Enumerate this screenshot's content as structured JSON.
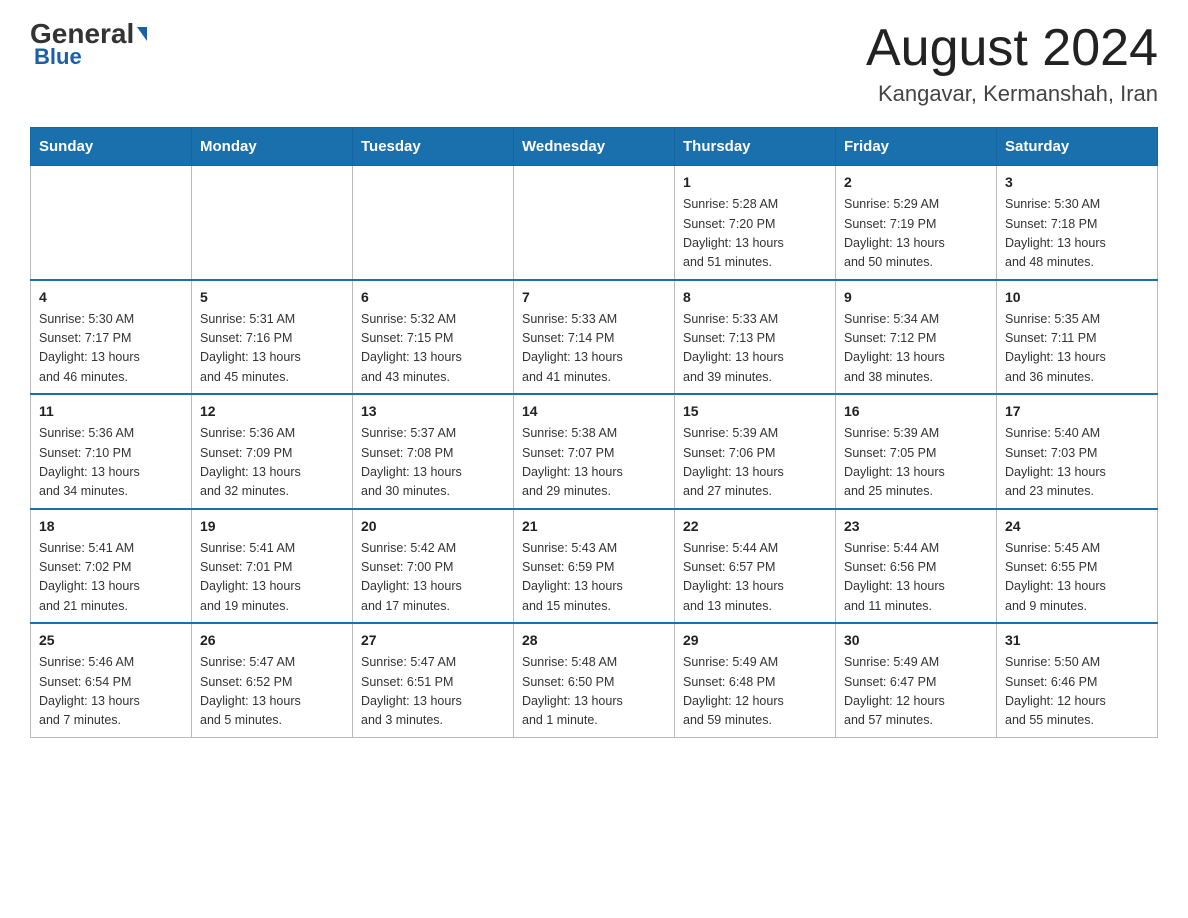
{
  "header": {
    "logo_general": "General",
    "logo_blue": "Blue",
    "month_title": "August 2024",
    "location": "Kangavar, Kermanshah, Iran"
  },
  "days_of_week": [
    "Sunday",
    "Monday",
    "Tuesday",
    "Wednesday",
    "Thursday",
    "Friday",
    "Saturday"
  ],
  "weeks": [
    [
      {
        "day": "",
        "info": ""
      },
      {
        "day": "",
        "info": ""
      },
      {
        "day": "",
        "info": ""
      },
      {
        "day": "",
        "info": ""
      },
      {
        "day": "1",
        "info": "Sunrise: 5:28 AM\nSunset: 7:20 PM\nDaylight: 13 hours\nand 51 minutes."
      },
      {
        "day": "2",
        "info": "Sunrise: 5:29 AM\nSunset: 7:19 PM\nDaylight: 13 hours\nand 50 minutes."
      },
      {
        "day": "3",
        "info": "Sunrise: 5:30 AM\nSunset: 7:18 PM\nDaylight: 13 hours\nand 48 minutes."
      }
    ],
    [
      {
        "day": "4",
        "info": "Sunrise: 5:30 AM\nSunset: 7:17 PM\nDaylight: 13 hours\nand 46 minutes."
      },
      {
        "day": "5",
        "info": "Sunrise: 5:31 AM\nSunset: 7:16 PM\nDaylight: 13 hours\nand 45 minutes."
      },
      {
        "day": "6",
        "info": "Sunrise: 5:32 AM\nSunset: 7:15 PM\nDaylight: 13 hours\nand 43 minutes."
      },
      {
        "day": "7",
        "info": "Sunrise: 5:33 AM\nSunset: 7:14 PM\nDaylight: 13 hours\nand 41 minutes."
      },
      {
        "day": "8",
        "info": "Sunrise: 5:33 AM\nSunset: 7:13 PM\nDaylight: 13 hours\nand 39 minutes."
      },
      {
        "day": "9",
        "info": "Sunrise: 5:34 AM\nSunset: 7:12 PM\nDaylight: 13 hours\nand 38 minutes."
      },
      {
        "day": "10",
        "info": "Sunrise: 5:35 AM\nSunset: 7:11 PM\nDaylight: 13 hours\nand 36 minutes."
      }
    ],
    [
      {
        "day": "11",
        "info": "Sunrise: 5:36 AM\nSunset: 7:10 PM\nDaylight: 13 hours\nand 34 minutes."
      },
      {
        "day": "12",
        "info": "Sunrise: 5:36 AM\nSunset: 7:09 PM\nDaylight: 13 hours\nand 32 minutes."
      },
      {
        "day": "13",
        "info": "Sunrise: 5:37 AM\nSunset: 7:08 PM\nDaylight: 13 hours\nand 30 minutes."
      },
      {
        "day": "14",
        "info": "Sunrise: 5:38 AM\nSunset: 7:07 PM\nDaylight: 13 hours\nand 29 minutes."
      },
      {
        "day": "15",
        "info": "Sunrise: 5:39 AM\nSunset: 7:06 PM\nDaylight: 13 hours\nand 27 minutes."
      },
      {
        "day": "16",
        "info": "Sunrise: 5:39 AM\nSunset: 7:05 PM\nDaylight: 13 hours\nand 25 minutes."
      },
      {
        "day": "17",
        "info": "Sunrise: 5:40 AM\nSunset: 7:03 PM\nDaylight: 13 hours\nand 23 minutes."
      }
    ],
    [
      {
        "day": "18",
        "info": "Sunrise: 5:41 AM\nSunset: 7:02 PM\nDaylight: 13 hours\nand 21 minutes."
      },
      {
        "day": "19",
        "info": "Sunrise: 5:41 AM\nSunset: 7:01 PM\nDaylight: 13 hours\nand 19 minutes."
      },
      {
        "day": "20",
        "info": "Sunrise: 5:42 AM\nSunset: 7:00 PM\nDaylight: 13 hours\nand 17 minutes."
      },
      {
        "day": "21",
        "info": "Sunrise: 5:43 AM\nSunset: 6:59 PM\nDaylight: 13 hours\nand 15 minutes."
      },
      {
        "day": "22",
        "info": "Sunrise: 5:44 AM\nSunset: 6:57 PM\nDaylight: 13 hours\nand 13 minutes."
      },
      {
        "day": "23",
        "info": "Sunrise: 5:44 AM\nSunset: 6:56 PM\nDaylight: 13 hours\nand 11 minutes."
      },
      {
        "day": "24",
        "info": "Sunrise: 5:45 AM\nSunset: 6:55 PM\nDaylight: 13 hours\nand 9 minutes."
      }
    ],
    [
      {
        "day": "25",
        "info": "Sunrise: 5:46 AM\nSunset: 6:54 PM\nDaylight: 13 hours\nand 7 minutes."
      },
      {
        "day": "26",
        "info": "Sunrise: 5:47 AM\nSunset: 6:52 PM\nDaylight: 13 hours\nand 5 minutes."
      },
      {
        "day": "27",
        "info": "Sunrise: 5:47 AM\nSunset: 6:51 PM\nDaylight: 13 hours\nand 3 minutes."
      },
      {
        "day": "28",
        "info": "Sunrise: 5:48 AM\nSunset: 6:50 PM\nDaylight: 13 hours\nand 1 minute."
      },
      {
        "day": "29",
        "info": "Sunrise: 5:49 AM\nSunset: 6:48 PM\nDaylight: 12 hours\nand 59 minutes."
      },
      {
        "day": "30",
        "info": "Sunrise: 5:49 AM\nSunset: 6:47 PM\nDaylight: 12 hours\nand 57 minutes."
      },
      {
        "day": "31",
        "info": "Sunrise: 5:50 AM\nSunset: 6:46 PM\nDaylight: 12 hours\nand 55 minutes."
      }
    ]
  ]
}
